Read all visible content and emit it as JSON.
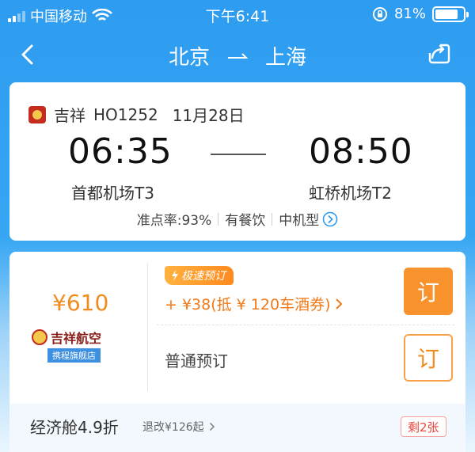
{
  "status_bar": {
    "carrier": "中国移动",
    "time": "下午6:41",
    "battery_percent": "81%",
    "battery_level": 0.81
  },
  "nav": {
    "origin": "北京",
    "destination": "上海"
  },
  "flight": {
    "airline": "吉祥",
    "flight_no": "HO1252",
    "date": "11月28日",
    "dep_time": "06:35",
    "arr_time": "08:50",
    "dep_airport": "首都机场T3",
    "arr_airport": "虹桥机场T2",
    "on_time_rate": "准点率:93%",
    "meal": "有餐饮",
    "aircraft": "中机型"
  },
  "booking": {
    "price": "¥610",
    "store_name": "吉祥航空",
    "store_sub": "携程旗舰店",
    "speed_tag": "极速预订",
    "promo": "+ ¥38(抵 ¥ 120车酒券)",
    "normal_label": "普通预订",
    "book_label": "订",
    "cabin": "经济舱4.9折",
    "refund": "退改¥126起",
    "remaining": "剩2张"
  },
  "colors": {
    "brand_blue": "#2e9cf0",
    "accent_orange": "#f7922d",
    "alert_red": "#e8463a"
  }
}
